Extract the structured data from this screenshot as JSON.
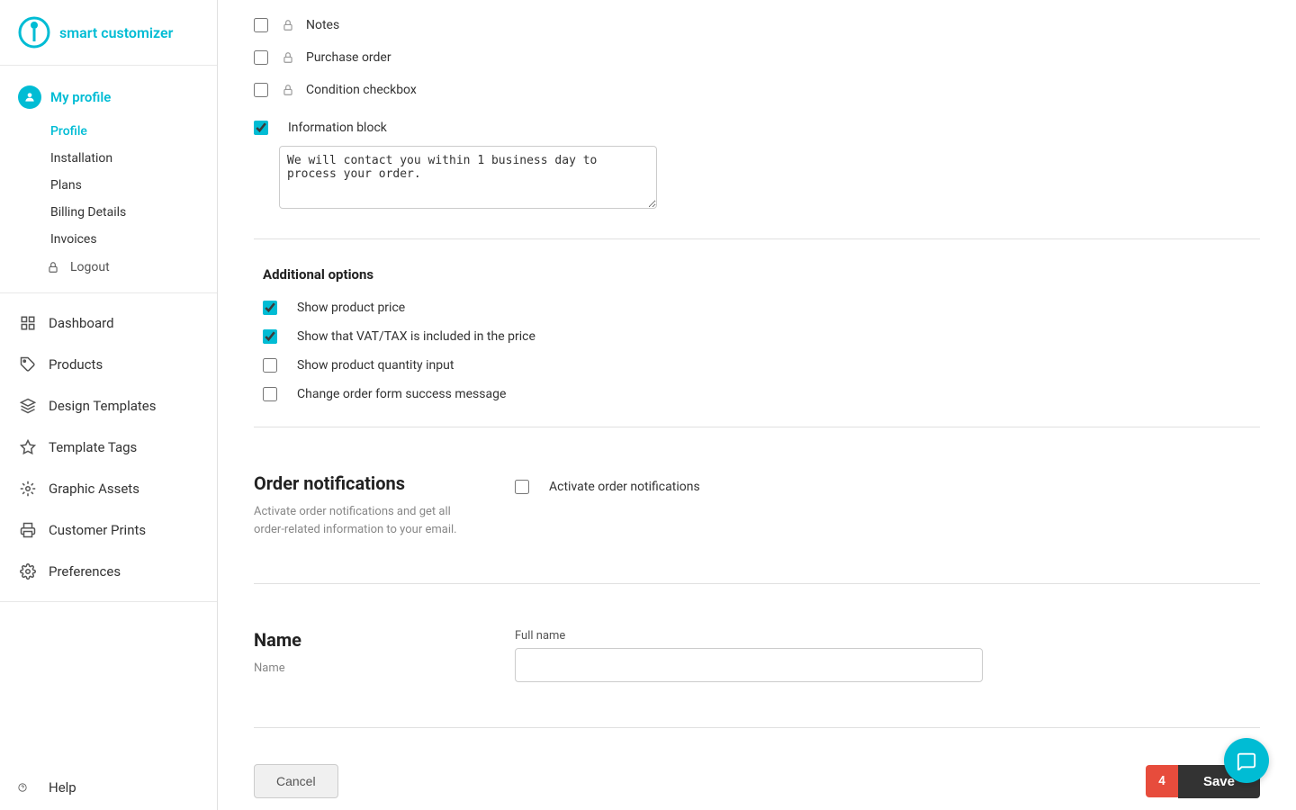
{
  "brand": {
    "name": "smart customizer",
    "logo_alt": "smart customizer logo"
  },
  "sidebar": {
    "my_profile_label": "My profile",
    "sub_items": [
      {
        "label": "Profile",
        "active": true
      },
      {
        "label": "Installation",
        "active": false
      },
      {
        "label": "Plans",
        "active": false
      },
      {
        "label": "Billing Details",
        "active": false
      },
      {
        "label": "Invoices",
        "active": false
      }
    ],
    "logout_label": "Logout",
    "nav_items": [
      {
        "label": "Dashboard",
        "icon": "dashboard-icon"
      },
      {
        "label": "Products",
        "icon": "products-icon"
      },
      {
        "label": "Design Templates",
        "icon": "design-templates-icon"
      },
      {
        "label": "Template Tags",
        "icon": "template-tags-icon"
      },
      {
        "label": "Graphic Assets",
        "icon": "graphic-assets-icon"
      },
      {
        "label": "Customer Prints",
        "icon": "customer-prints-icon"
      },
      {
        "label": "Preferences",
        "icon": "preferences-icon"
      }
    ],
    "help_label": "Help"
  },
  "main": {
    "checkboxes": [
      {
        "label": "Notes",
        "checked": false,
        "locked": true
      },
      {
        "label": "Purchase order",
        "checked": false,
        "locked": true
      },
      {
        "label": "Condition checkbox",
        "checked": false,
        "locked": true
      },
      {
        "label": "Information block",
        "checked": true,
        "locked": false
      }
    ],
    "info_block_text": "We will contact you within 1 business day to process your order.",
    "additional_options_title": "Additional options",
    "additional_options": [
      {
        "label": "Show product price",
        "checked": true
      },
      {
        "label": "Show that VAT/TAX is included in the price",
        "checked": true
      },
      {
        "label": "Show product quantity input",
        "checked": false
      },
      {
        "label": "Change order form success message",
        "checked": false
      }
    ],
    "order_notifications": {
      "title": "Order notifications",
      "description": "Activate order notifications and get all order-related information to your email.",
      "checkbox_label": "Activate order notifications",
      "checked": false
    },
    "name_section": {
      "title": "Name",
      "description": "Name",
      "full_name_label": "Full name",
      "full_name_placeholder": ""
    },
    "cancel_label": "Cancel",
    "save_label": "Save",
    "badge_count": "4"
  }
}
